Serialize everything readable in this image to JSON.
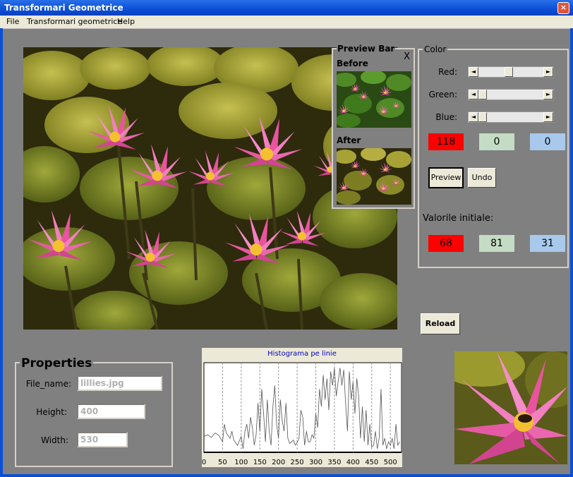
{
  "window": {
    "title": "Transformari Geometrice",
    "close": "×"
  },
  "menu": [
    {
      "label": "File"
    },
    {
      "label": "Transformari geometrice"
    },
    {
      "label": "Help"
    }
  ],
  "preview_bar": {
    "title": "Preview Bar",
    "close": "X",
    "before_label": "Before",
    "after_label": "After"
  },
  "color_panel": {
    "title": "Color",
    "red_label": "Red:",
    "green_label": "Green:",
    "blue_label": "Blue:",
    "red_value": "118",
    "green_value": "0",
    "blue_value": "0",
    "red_level": 0.46,
    "green_level": 0.0,
    "blue_level": 0.0,
    "preview_label": "Preview",
    "undo_label": "Undo",
    "initial_label": "Valorile initiale:",
    "init_red": "68",
    "init_green": "81",
    "init_blue": "31",
    "colors": {
      "red": "#ff0000",
      "green": "#c4dcc4",
      "blue": "#a8c8ec"
    }
  },
  "reload_label": "Reload",
  "properties": {
    "title": "Properties",
    "file_label": "File_name:",
    "file_value": "lillies.jpg",
    "height_label": "Height:",
    "height_value": "400",
    "width_label": "Width:",
    "width_value": "530"
  },
  "histogram": {
    "title": "Histograma pe linie",
    "chart_data": {
      "type": "line",
      "title": "Histograma pe linie",
      "xlim": [
        0,
        530
      ],
      "ylim": [
        0,
        255
      ],
      "x_ticks": [
        "0",
        "50",
        "100",
        "150",
        "200",
        "250",
        "300",
        "350",
        "400",
        "450",
        "500"
      ],
      "x_tick_values": [
        0,
        50,
        100,
        150,
        200,
        250,
        300,
        350,
        400,
        450,
        500
      ],
      "series": [
        {
          "values": [
            [
              0,
              45
            ],
            [
              10,
              50
            ],
            [
              20,
              42
            ],
            [
              30,
              55
            ],
            [
              40,
              48
            ],
            [
              50,
              30
            ],
            [
              55,
              80
            ],
            [
              60,
              55
            ],
            [
              70,
              40
            ],
            [
              75,
              60
            ],
            [
              80,
              35
            ],
            [
              90,
              20
            ],
            [
              100,
              45
            ],
            [
              105,
              10
            ],
            [
              110,
              60
            ],
            [
              115,
              80
            ],
            [
              120,
              40
            ],
            [
              125,
              100
            ],
            [
              130,
              70
            ],
            [
              135,
              20
            ],
            [
              140,
              50
            ],
            [
              145,
              140
            ],
            [
              150,
              60
            ],
            [
              155,
              180
            ],
            [
              160,
              110
            ],
            [
              165,
              30
            ],
            [
              170,
              150
            ],
            [
              175,
              60
            ],
            [
              180,
              20
            ],
            [
              185,
              130
            ],
            [
              190,
              190
            ],
            [
              195,
              80
            ],
            [
              200,
              40
            ],
            [
              205,
              150
            ],
            [
              210,
              90
            ],
            [
              215,
              60
            ],
            [
              220,
              140
            ],
            [
              225,
              40
            ],
            [
              230,
              25
            ],
            [
              235,
              30
            ],
            [
              240,
              35
            ],
            [
              245,
              20
            ],
            [
              250,
              28
            ],
            [
              255,
              40
            ],
            [
              260,
              120
            ],
            [
              265,
              100
            ],
            [
              270,
              20
            ],
            [
              275,
              60
            ],
            [
              280,
              30
            ],
            [
              285,
              30
            ],
            [
              290,
              50
            ],
            [
              295,
              40
            ],
            [
              300,
              110
            ],
            [
              305,
              70
            ],
            [
              310,
              180
            ],
            [
              315,
              130
            ],
            [
              320,
              220
            ],
            [
              325,
              150
            ],
            [
              330,
              210
            ],
            [
              335,
              120
            ],
            [
              340,
              230
            ],
            [
              345,
              190
            ],
            [
              350,
              240
            ],
            [
              355,
              160
            ],
            [
              360,
              200
            ],
            [
              365,
              240
            ],
            [
              370,
              190
            ],
            [
              375,
              235
            ],
            [
              380,
              140
            ],
            [
              385,
              60
            ],
            [
              390,
              230
            ],
            [
              395,
              150
            ],
            [
              400,
              200
            ],
            [
              405,
              110
            ],
            [
              410,
              210
            ],
            [
              415,
              160
            ],
            [
              420,
              40
            ],
            [
              425,
              130
            ],
            [
              430,
              30
            ],
            [
              435,
              120
            ],
            [
              440,
              20
            ],
            [
              445,
              80
            ],
            [
              450,
              15
            ],
            [
              455,
              20
            ],
            [
              460,
              60
            ],
            [
              465,
              10
            ],
            [
              470,
              40
            ],
            [
              475,
              180
            ],
            [
              480,
              20
            ],
            [
              485,
              40
            ],
            [
              490,
              10
            ],
            [
              495,
              30
            ],
            [
              500,
              20
            ],
            [
              505,
              40
            ],
            [
              510,
              10
            ],
            [
              515,
              80
            ],
            [
              520,
              20
            ],
            [
              525,
              30
            ]
          ]
        }
      ]
    }
  }
}
